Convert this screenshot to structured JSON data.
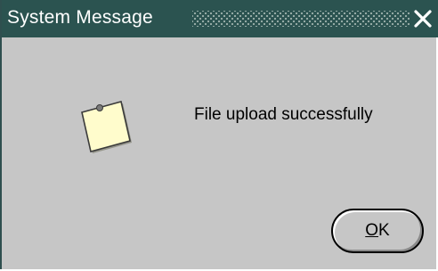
{
  "window": {
    "title": "System Message",
    "close_glyph": "✕",
    "colors": {
      "titlebar": "#2b5350",
      "background": "#c6c6c6",
      "note": "#fffccc"
    }
  },
  "dialog": {
    "icon": "sticky-note-icon",
    "message": "File upload successfully"
  },
  "buttons": {
    "ok": {
      "mnemonic": "O",
      "rest": "K"
    }
  }
}
